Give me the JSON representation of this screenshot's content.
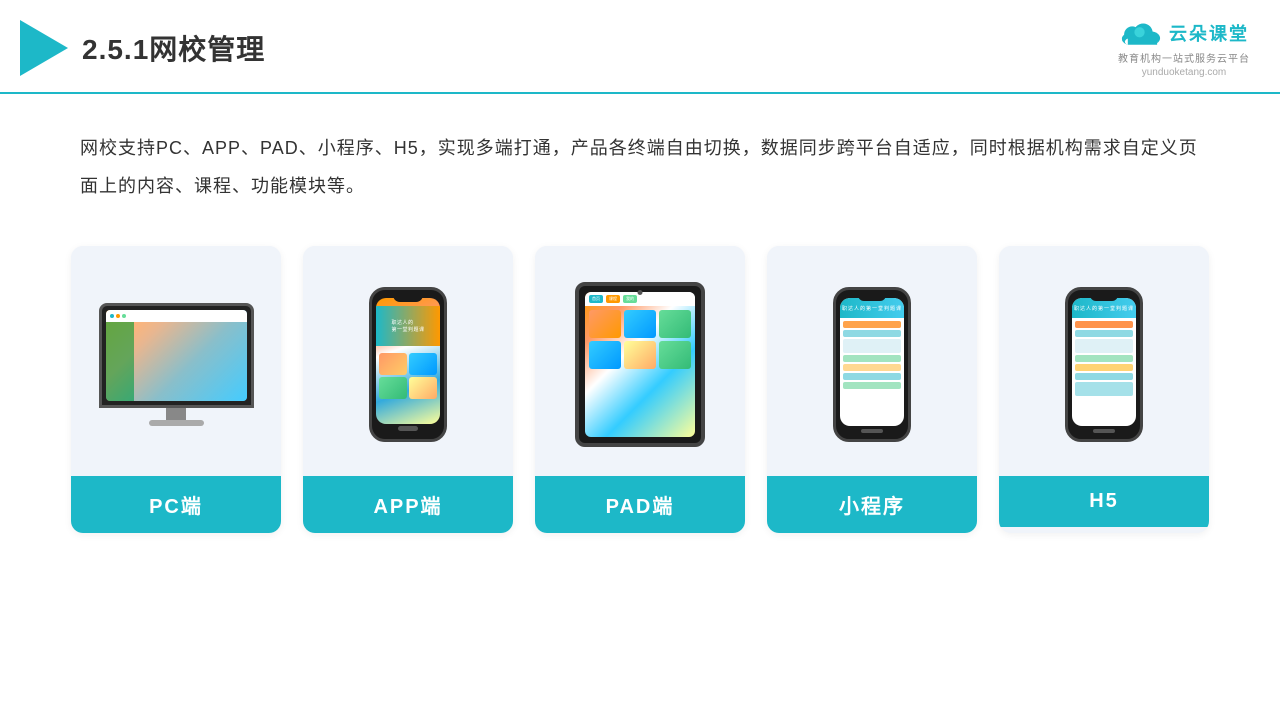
{
  "header": {
    "title": "2.5.1网校管理",
    "brand": {
      "name": "云朵课堂",
      "slogan": "教育机构一站式服务云平台",
      "url": "yunduoketang.com"
    }
  },
  "description": "网校支持PC、APP、PAD、小程序、H5，实现多端打通，产品各终端自由切换，数据同步跨平台自适应，同时根据机构需求自定义页面上的内容、课程、功能模块等。",
  "cards": [
    {
      "id": "pc",
      "label": "PC端"
    },
    {
      "id": "app",
      "label": "APP端"
    },
    {
      "id": "pad",
      "label": "PAD端"
    },
    {
      "id": "miniprogram",
      "label": "小程序"
    },
    {
      "id": "h5",
      "label": "H5"
    }
  ]
}
